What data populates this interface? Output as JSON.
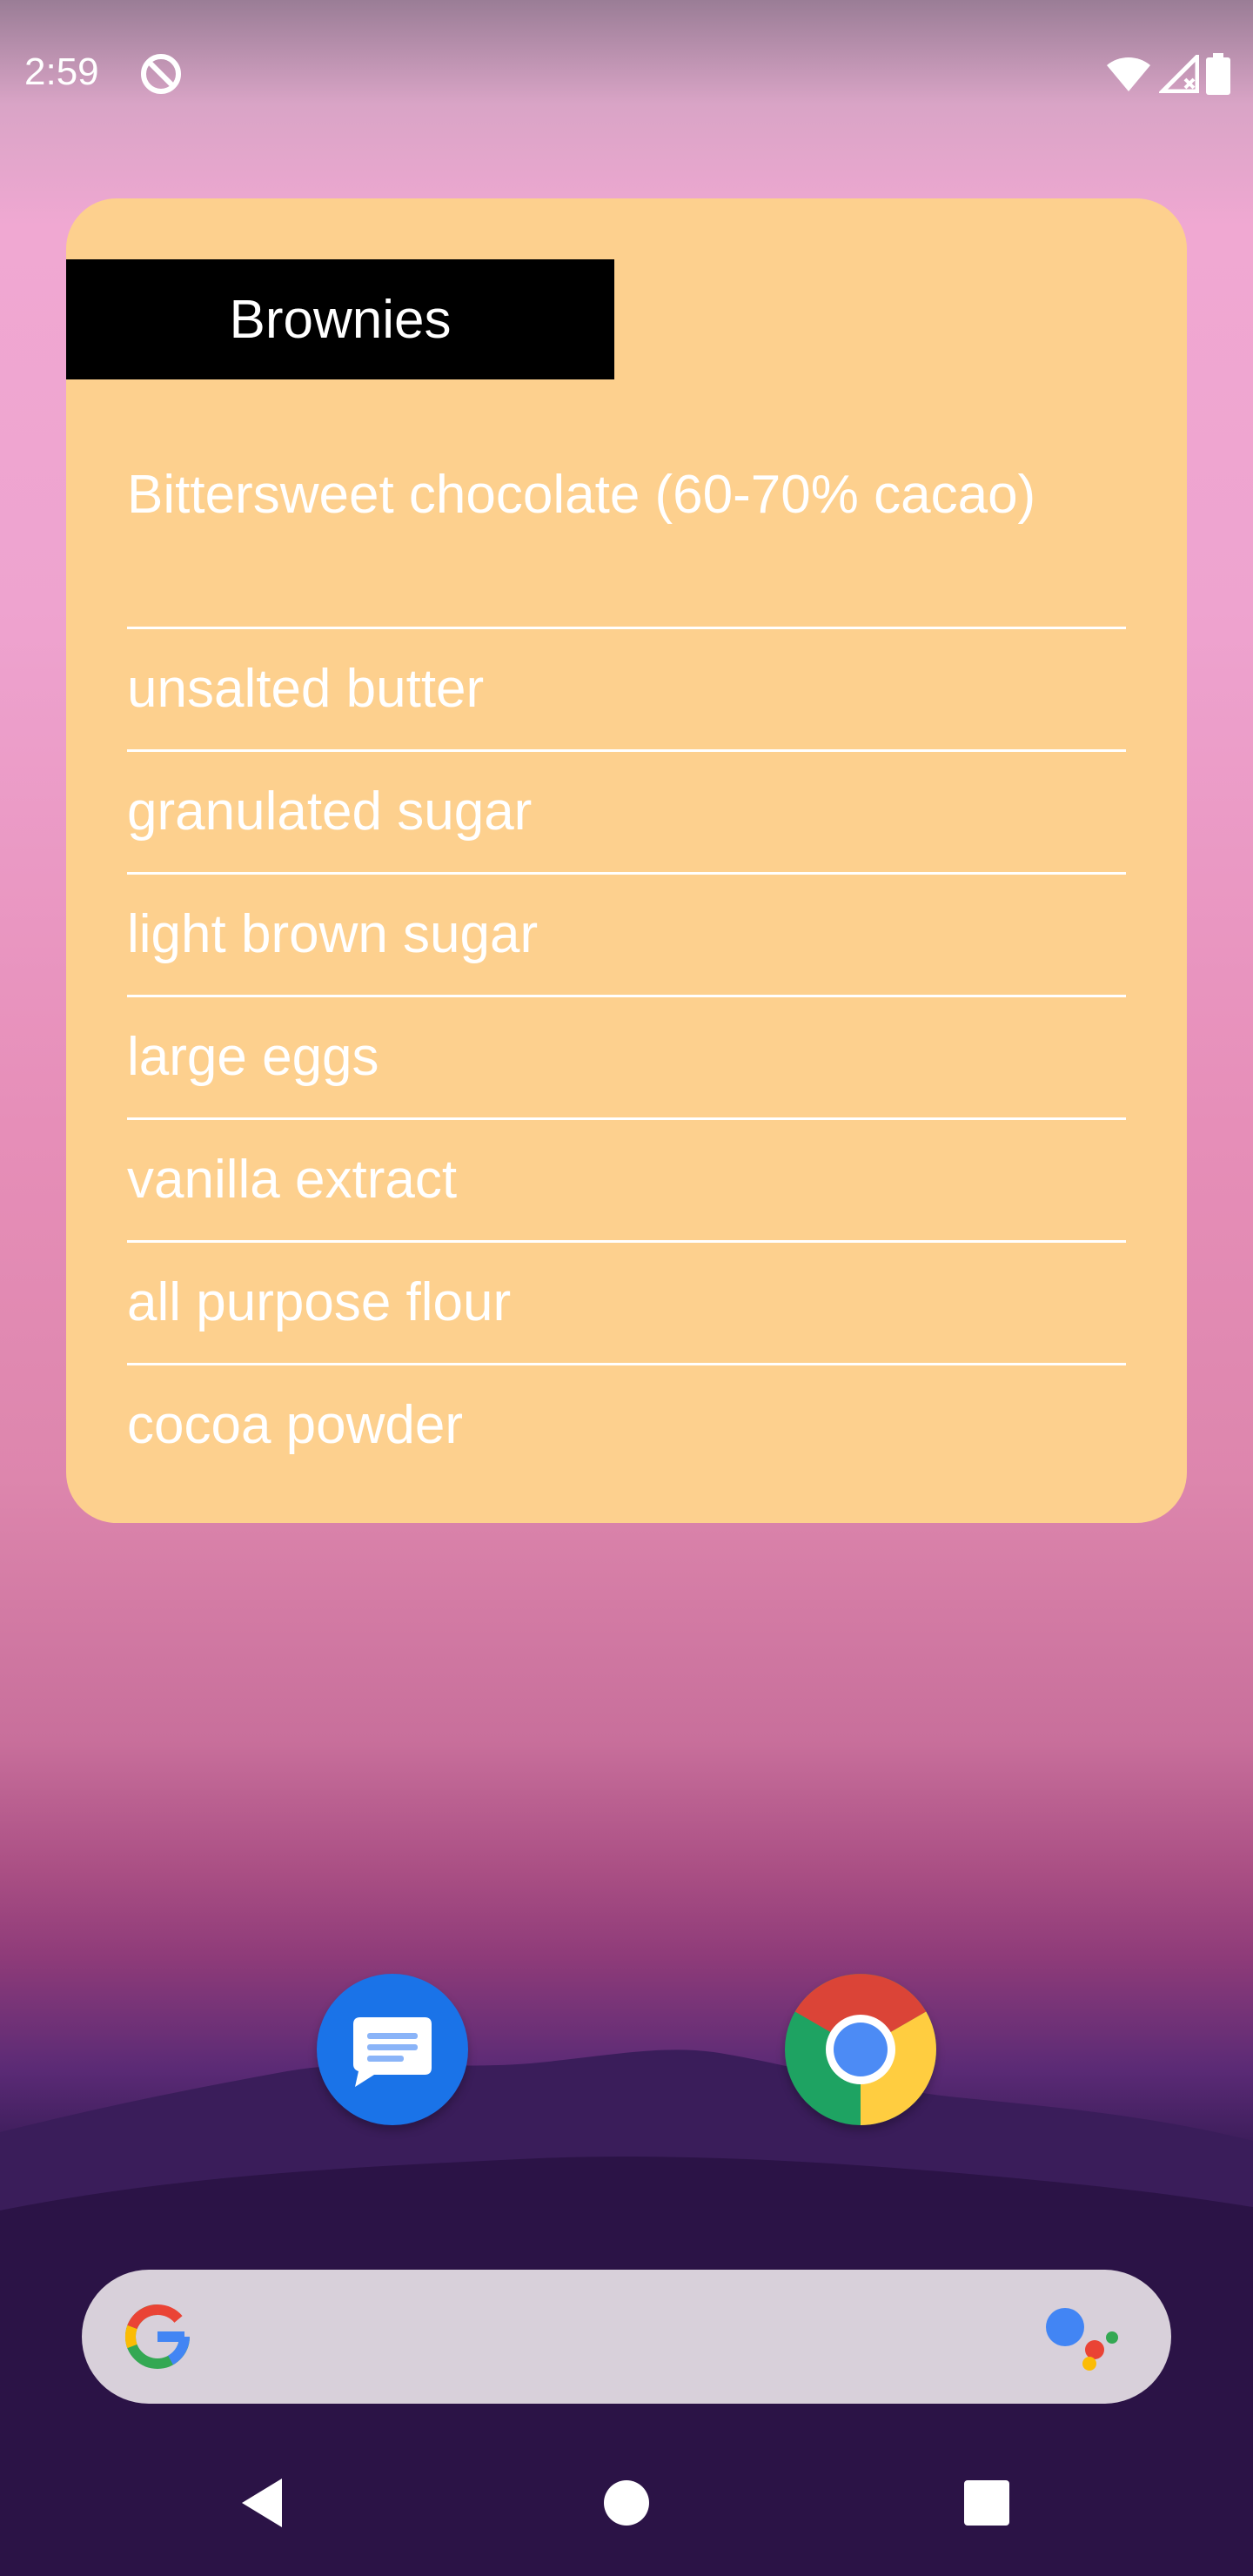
{
  "status_bar": {
    "time": "2:59",
    "icons": [
      "do-not-disturb-icon",
      "wifi-icon",
      "cell-signal-icon",
      "battery-icon"
    ]
  },
  "widget": {
    "title": "Brownies",
    "ingredients": [
      "Bittersweet chocolate (60-70% cacao)",
      "unsalted butter",
      "granulated sugar",
      "light brown sugar",
      "large eggs",
      "vanilla extract",
      "all purpose flour",
      "cocoa powder"
    ],
    "colors": {
      "background": "#fdd08e",
      "title_background": "#000000",
      "text": "#ffffff"
    }
  },
  "dock": {
    "apps": [
      "messages-icon",
      "chrome-icon"
    ]
  },
  "search_bar": {
    "icons": [
      "google-g-icon",
      "google-assistant-icon"
    ]
  },
  "nav_bar": {
    "buttons": [
      "back-icon",
      "home-icon",
      "recents-icon"
    ]
  }
}
